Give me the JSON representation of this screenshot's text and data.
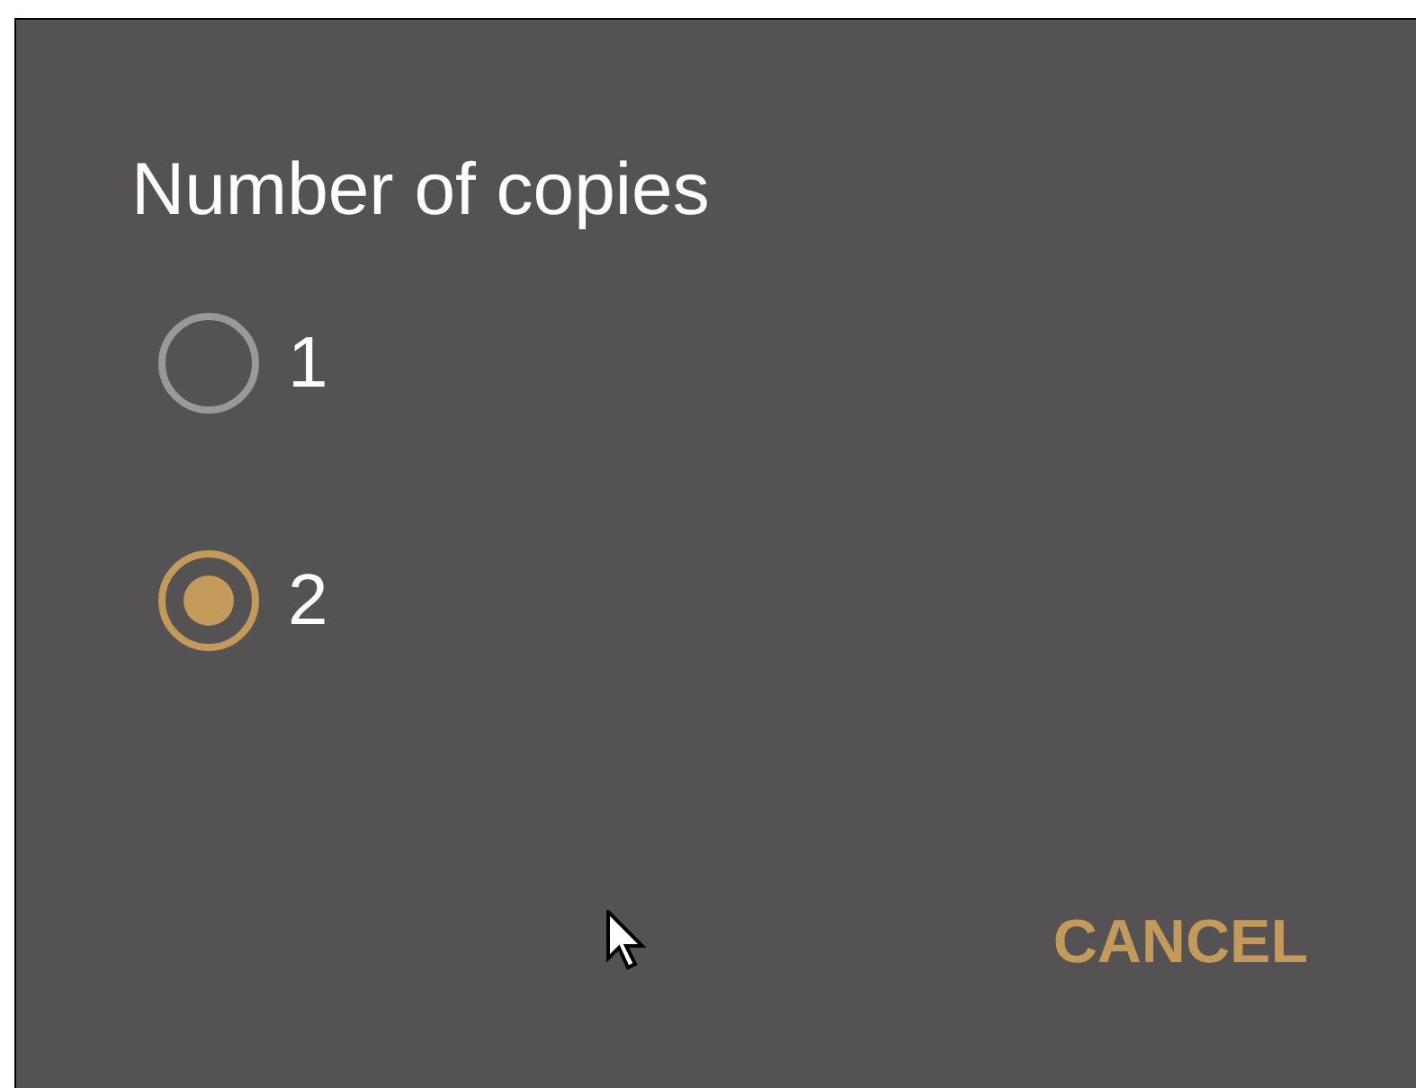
{
  "dialog": {
    "title": "Number of copies",
    "options": [
      {
        "label": "1",
        "selected": false
      },
      {
        "label": "2",
        "selected": true
      }
    ],
    "buttons": [
      {
        "label": "CANCEL"
      }
    ]
  }
}
